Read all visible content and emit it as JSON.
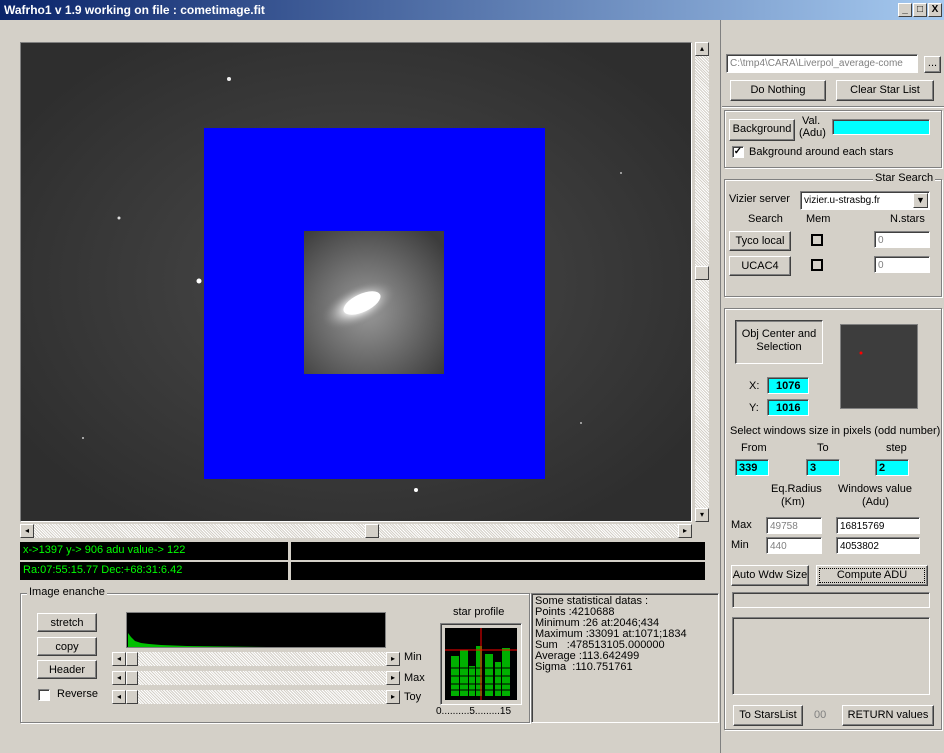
{
  "window": {
    "title": "Wafrho1 v 1.9 working on file : cometimage.fit",
    "btn_min": "_",
    "btn_max": "□",
    "btn_close": "X"
  },
  "colors": {
    "overlay": "#0000ff",
    "status_text": "#00ff00",
    "field": "#00ffff"
  },
  "file": {
    "path": "C:\\tmp4\\CARA\\Liverpol_average-come",
    "browse_label": "...",
    "do_nothing": "Do Nothing",
    "clear_star_list": "Clear Star List"
  },
  "background": {
    "button": "Background",
    "val_label_1": "Val.",
    "val_label_2": "(Adu)",
    "value": "",
    "checkbox_label": "Bakground around each stars",
    "checked": "✓"
  },
  "star_search": {
    "title": "Star Search",
    "server_label": "Vizier server",
    "server_value": "vizier.u-strasbg.fr",
    "col_search": "Search",
    "col_mem": "Mem",
    "col_nstars": "N.stars",
    "rows": [
      {
        "button": "Tyco local",
        "count": "0"
      },
      {
        "button": "UCAC4",
        "count": "0"
      }
    ]
  },
  "objcenter": {
    "button_line1": "Obj Center and",
    "button_line2": "Selection",
    "x_label": "X:",
    "x_value": "1076",
    "y_label": "Y:",
    "y_value": "1016",
    "windows_label": "Select windows size in pixels (odd number)",
    "from_label": "From",
    "to_label": "To",
    "step_label": "step",
    "from_value": "339",
    "to_value": "3",
    "step_value": "2",
    "eq_radius_1": "Eq.Radius",
    "eq_radius_2": "(Km)",
    "win_value_1": "Windows value",
    "win_value_2": "(Adu)",
    "max_label": "Max",
    "max_radius": "49758",
    "max_value": "16815769",
    "min_label": "Min",
    "min_radius": "440",
    "min_value": "4053802",
    "auto_wdw": "Auto Wdw Size",
    "compute_adu": "Compute ADU",
    "to_stars_list": "To StarsList",
    "counter": "00",
    "return_values": "RETURN values"
  },
  "status": {
    "line1": "x->1397 y-> 906 adu value->        122",
    "line2": "Ra:07:55:15.77 Dec:+68:31:6.42"
  },
  "enhance": {
    "title": "Image enanche",
    "stretch": "stretch",
    "copy": "copy",
    "header": "Header",
    "reverse": "Reverse",
    "slider_min": "Min",
    "slider_max": "Max",
    "slider_toy": "Toy",
    "star_profile": "star profile",
    "profile_axis": "0..........5.........15"
  },
  "stats": {
    "lines": [
      "Some statistical datas :",
      "Points :4210688",
      "Minimum :26 at:2046;434",
      "Maximum :33091 at:1071;1834",
      "Sum   :478513105.000000",
      "Average :113.642499",
      "Sigma  :110.751761"
    ]
  }
}
